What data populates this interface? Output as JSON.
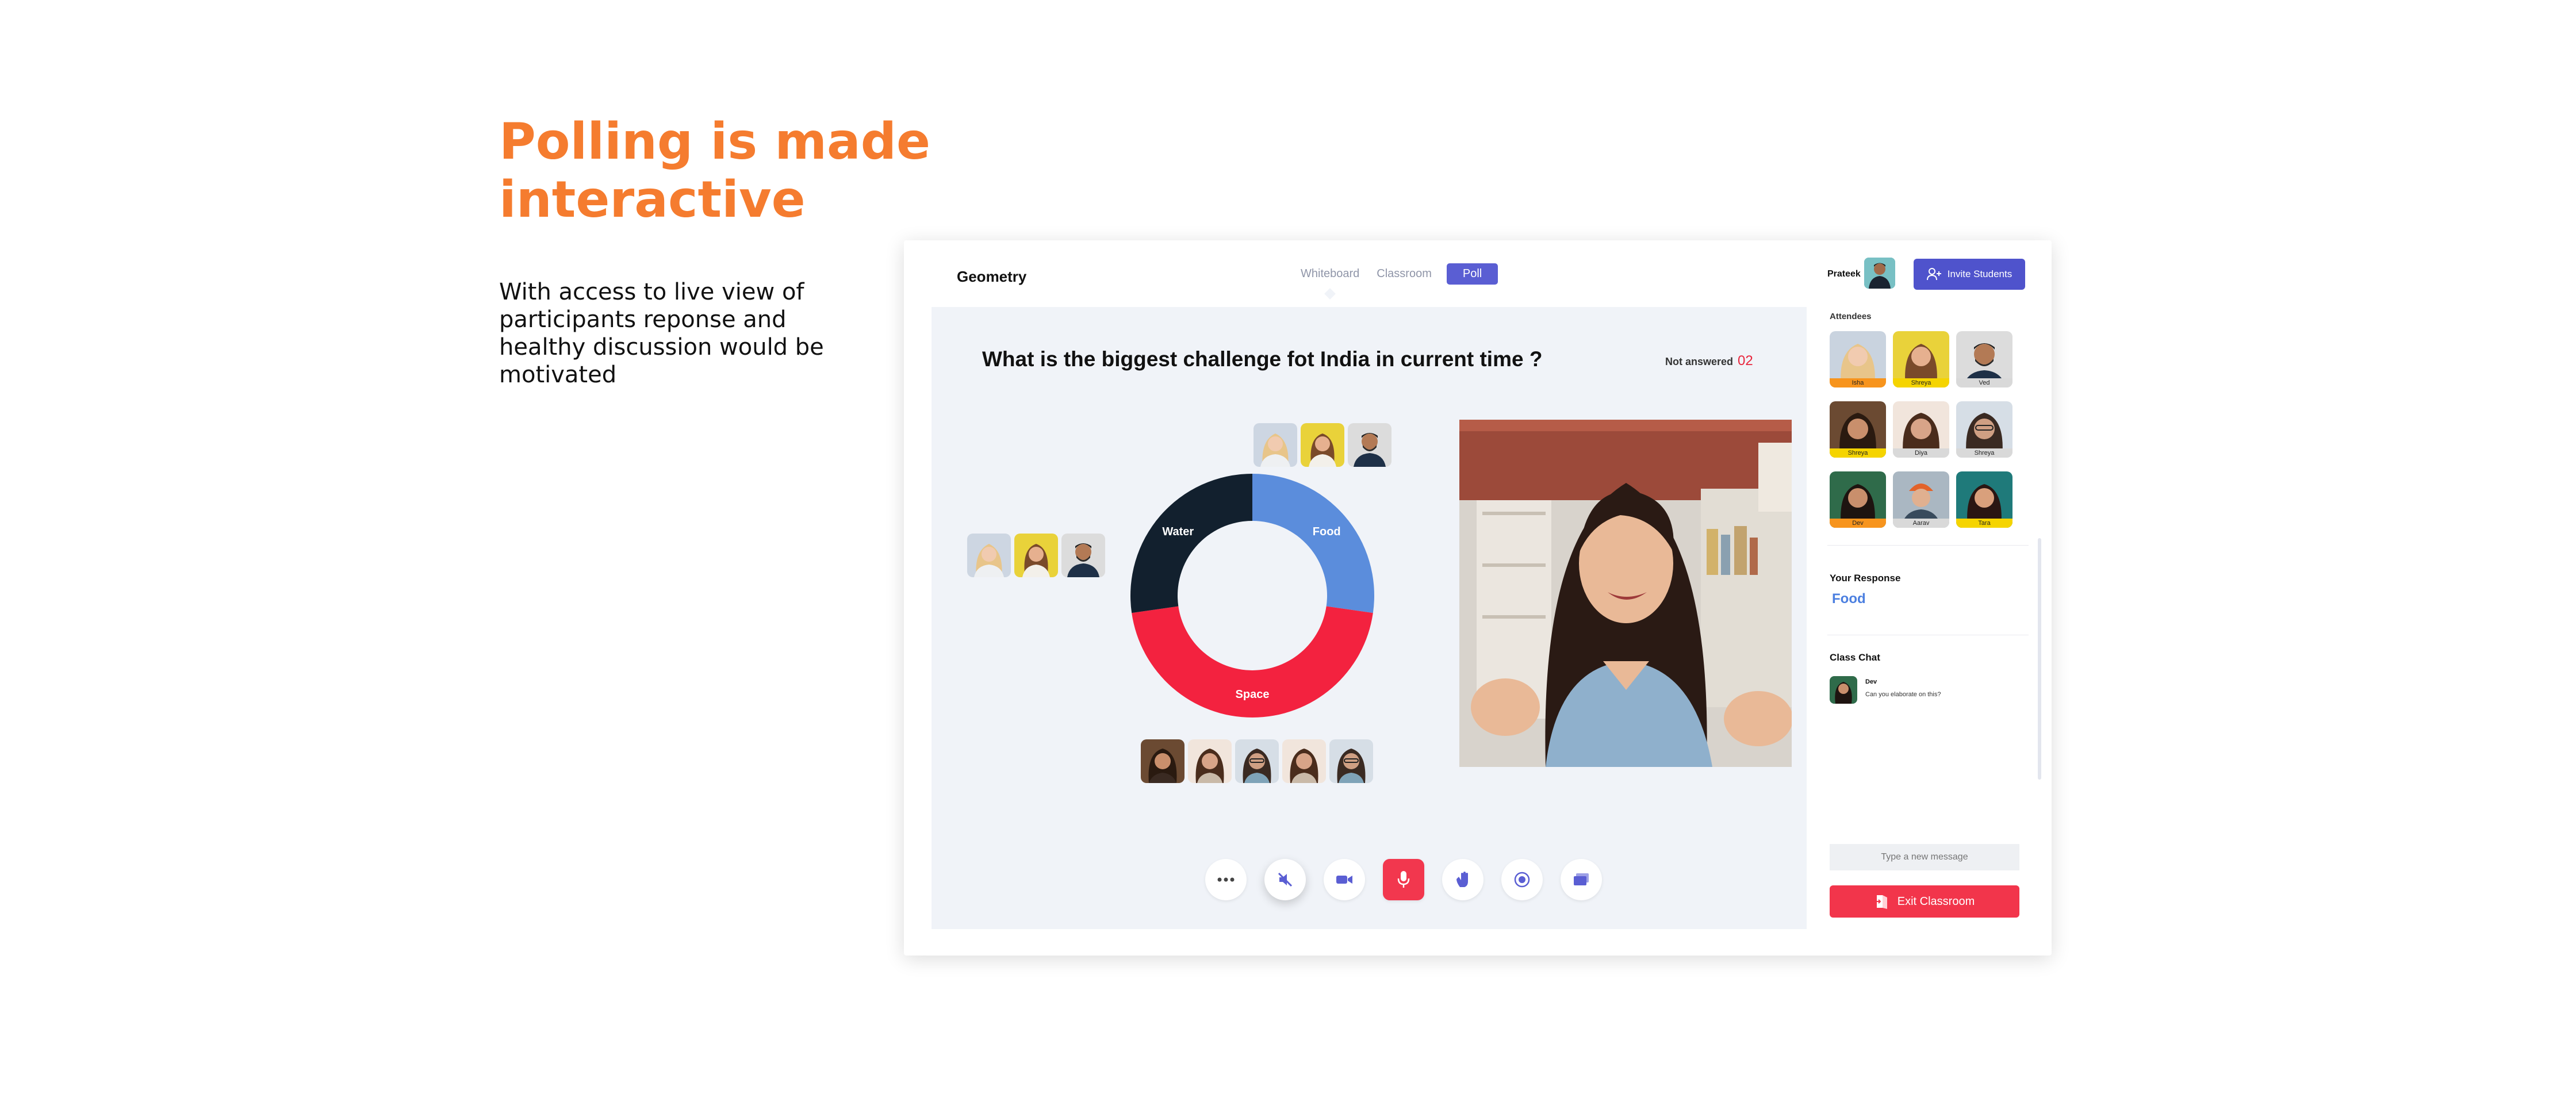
{
  "hero": {
    "title": "Polling is made interactive",
    "description": "With access to live view of participants reponse and healthy discussion would be motivated"
  },
  "app": {
    "title": "Geometry",
    "tabs": [
      {
        "label": "Whiteboard",
        "state": "indicator"
      },
      {
        "label": "Classroom",
        "state": "inactive"
      },
      {
        "label": "Poll",
        "state": "active"
      }
    ],
    "user_name": "Prateek",
    "invite_label": "Invite Students"
  },
  "poll": {
    "question": "What is the biggest challenge fot India in current time ?",
    "not_answered_label": "Not answered",
    "not_answered_count": "02"
  },
  "chart_data": {
    "type": "pie",
    "categories": [
      "Food",
      "Space",
      "Water"
    ],
    "values": [
      3,
      5,
      3
    ],
    "colors": [
      "#5b8ddc",
      "#f3223f",
      "#12202e"
    ],
    "hole": true
  },
  "sidebar": {
    "attendees_title": "Attendees",
    "attendees": [
      {
        "name": "Isha",
        "color": "#f7941d"
      },
      {
        "name": "Shreya",
        "color": "#f5d400"
      },
      {
        "name": "Ved",
        "color": "#d9d9d9"
      },
      {
        "name": "Shreya",
        "color": "#f5d400"
      },
      {
        "name": "Diya",
        "color": "#d9d9d9"
      },
      {
        "name": "Shreya",
        "color": "#d9d9d9"
      },
      {
        "name": "Dev",
        "color": "#f7941d"
      },
      {
        "name": "Aarav",
        "color": "#d9d9d9"
      },
      {
        "name": "Tara",
        "color": "#f5d400"
      }
    ],
    "response_title": "Your Response",
    "response_value": "Food",
    "chat_title": "Class Chat",
    "chat": {
      "name": "Dev",
      "text": "Can you elaborate on this?"
    },
    "message_placeholder": "Type a new message",
    "exit_label": "Exit Classroom"
  },
  "controls": [
    {
      "name": "more-button",
      "icon": "more-icon"
    },
    {
      "name": "speaker-off-button",
      "icon": "speaker-off-icon"
    },
    {
      "name": "video-button",
      "icon": "video-camera-icon"
    },
    {
      "name": "mic-button",
      "icon": "microphone-icon"
    },
    {
      "name": "raise-hand-button",
      "icon": "hand-icon"
    },
    {
      "name": "record-button",
      "icon": "record-icon"
    },
    {
      "name": "screen-share-button",
      "icon": "screen-share-icon"
    }
  ]
}
